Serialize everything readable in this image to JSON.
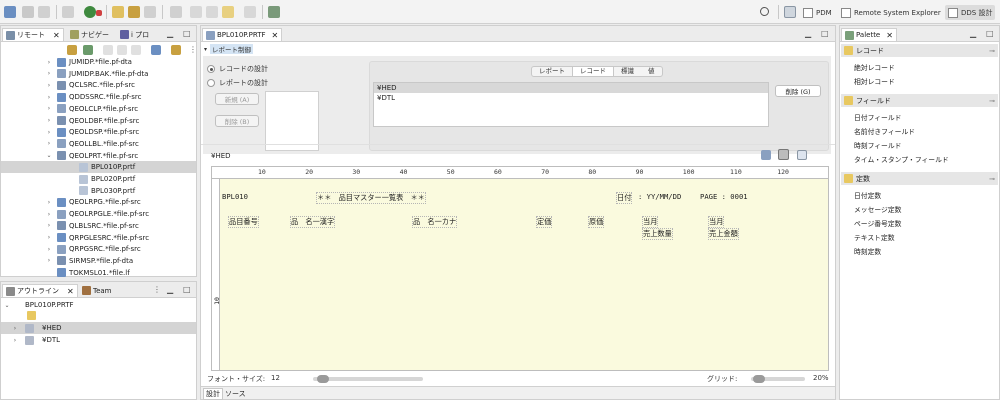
{
  "toolbar": {
    "perspectives": [
      {
        "label": "PDM",
        "active": false
      },
      {
        "label": "Remote System Explorer",
        "active": false
      },
      {
        "label": "DDS 設計",
        "active": true
      }
    ]
  },
  "left_top": {
    "tabs": [
      {
        "label": "リモート",
        "closable": true,
        "active": true
      },
      {
        "label": "ナビゲー",
        "closable": false,
        "active": false
      },
      {
        "label": "i プロ",
        "closable": false,
        "active": false
      }
    ],
    "tree": [
      {
        "label": "JUMIDP.*file.pf-dta",
        "expand": "right"
      },
      {
        "label": "JUMIDP.BAK.*file.pf-dta",
        "expand": "right"
      },
      {
        "label": "QCLSRC.*file.pf-src",
        "expand": "right"
      },
      {
        "label": "QDDSSRC.*file.pf-src",
        "expand": "right"
      },
      {
        "label": "QEOLCLP.*file.pf-src",
        "expand": "right"
      },
      {
        "label": "QEOLDBF.*file.pf-src",
        "expand": "right"
      },
      {
        "label": "QEOLDSP.*file.pf-src",
        "expand": "right"
      },
      {
        "label": "QEOLLBL.*file.pf-src",
        "expand": "right"
      },
      {
        "label": "QEOLPRT.*file.pf-src",
        "expand": "down"
      },
      {
        "label": "BPL010P.prtf",
        "expand": "",
        "child": true,
        "selected": true
      },
      {
        "label": "BPL020P.prtf",
        "expand": "",
        "child": true
      },
      {
        "label": "BPL030P.prtf",
        "expand": "",
        "child": true
      },
      {
        "label": "QEOLRPG.*file.pf-src",
        "expand": "right"
      },
      {
        "label": "QEOLRPGLE.*file.pf-src",
        "expand": "right"
      },
      {
        "label": "QLBLSRC.*file.pf-src",
        "expand": "right"
      },
      {
        "label": "QRPGLESRC.*file.pf-src",
        "expand": "right"
      },
      {
        "label": "QRPGSRC.*file.pf-src",
        "expand": "right"
      },
      {
        "label": "SIRMSP.*file.pf-dta",
        "expand": "right"
      },
      {
        "label": "TOKMSL01.*file.lf",
        "expand": ""
      }
    ]
  },
  "left_bottom": {
    "tabs": [
      {
        "label": "アウトライン",
        "closable": true,
        "active": true
      },
      {
        "label": "Team",
        "closable": false,
        "active": false
      }
    ],
    "root": "BPL010P.PRTF",
    "records": [
      {
        "label": "¥HED",
        "selected": true
      },
      {
        "label": "¥DTL",
        "selected": false
      }
    ]
  },
  "editor": {
    "tab": "BPL010P.PRTF",
    "section_label": "レポート制御",
    "radio_design": "レコードの設計",
    "radio_report": "レポートの設計",
    "btn_new": "新規 (A)",
    "btn_delete_left": "削除 (B)",
    "seg_tabs": [
      {
        "label": "レポート",
        "on": false
      },
      {
        "label": "レコード",
        "on": true
      },
      {
        "label": "標識",
        "on": false
      },
      {
        "label": "値",
        "on": false
      }
    ],
    "records": [
      {
        "label": "¥HED",
        "selected": true
      },
      {
        "label": "¥DTL",
        "selected": false
      }
    ],
    "btn_delete_right": "削除 (G)",
    "current_record": "¥HED",
    "ruler_labels": [
      "10",
      "20",
      "30",
      "40",
      "50",
      "60",
      "70",
      "80",
      "90",
      "100",
      "110",
      "120"
    ],
    "left_ruler_label": "10",
    "lines": {
      "title_prefix": "BPL010",
      "title": "＊＊　品目マスター一覧表　＊＊",
      "date_label": "日付",
      "date_value": ": YY/MM/DD",
      "page_label": "PAGE : 0001",
      "h_item_no": "品目番号",
      "h_name_kanji": "品　名一漢字",
      "h_name_kana": "品　名一カナ",
      "h_price": "定価",
      "h_cost": "原価",
      "h_month1": "当月",
      "h_month2": "当月",
      "h_qty": "売上数量",
      "h_amount": "売上金額"
    },
    "font_size_label": "フォント・サイズ:",
    "font_size_value": "12",
    "grid_label": "グリッド:",
    "grid_value": "20%",
    "bottom_tabs": [
      {
        "label": "設計",
        "active": true
      },
      {
        "label": "ソース",
        "active": false
      }
    ]
  },
  "palette": {
    "tab": "Palette",
    "categories": [
      {
        "label": "レコード",
        "items": [
          "絶対レコード",
          "相対レコード"
        ]
      },
      {
        "label": "フィールド",
        "items": [
          "日付フィールド",
          "名前付きフィールド",
          "時刻フィールド",
          "タイム・スタンプ・フィールド"
        ]
      },
      {
        "label": "定数",
        "items": [
          "日付定数",
          "メッセージ定数",
          "ページ番号定数",
          "テキスト定数",
          "時刻定数"
        ]
      }
    ]
  }
}
